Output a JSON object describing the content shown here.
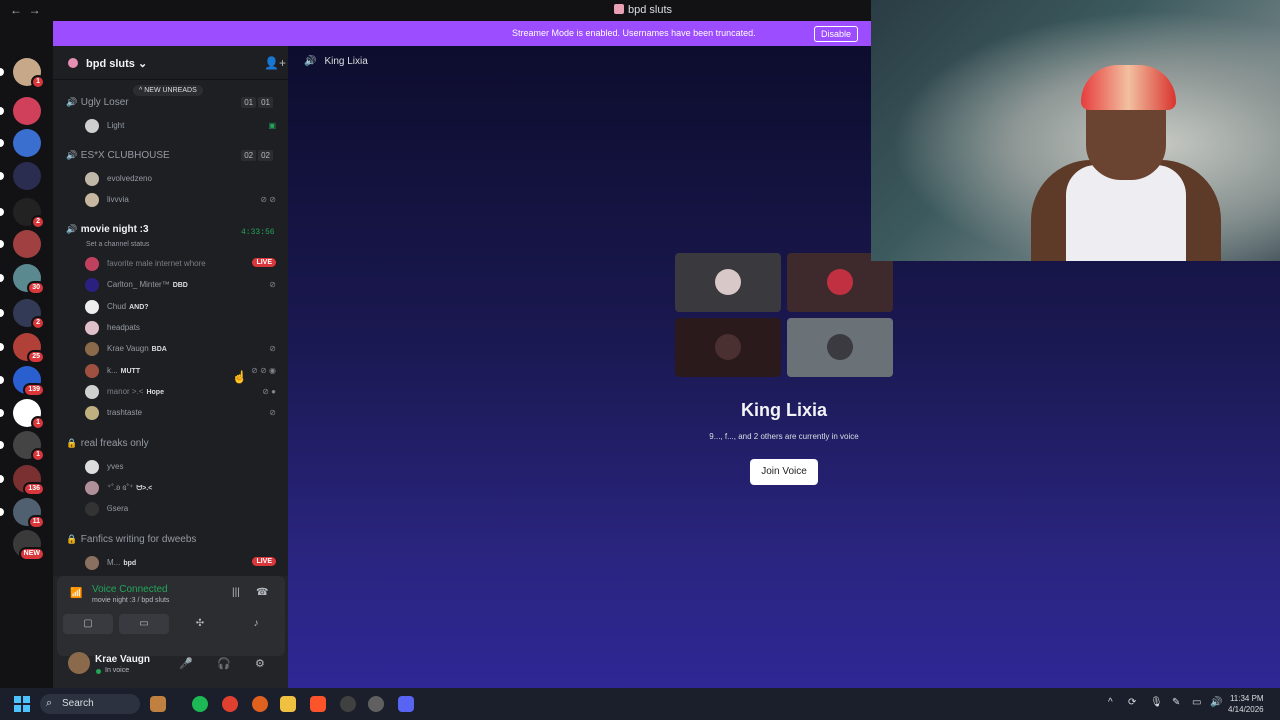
{
  "window": {
    "title": "bpd sluts",
    "back": "←",
    "forward": "→"
  },
  "banner": {
    "text": "Streamer Mode is enabled. Usernames have been truncated.",
    "button": "Disable"
  },
  "servers": [
    {
      "color": "#5865f2",
      "badge": ""
    },
    {
      "color": "#c7a98a",
      "badge": "1"
    },
    {
      "color": "#d0405a",
      "badge": ""
    },
    {
      "color": "#3a6fd0",
      "badge": ""
    },
    {
      "color": "#2a2d50",
      "badge": ""
    },
    {
      "color": "#222222",
      "badge": "2"
    },
    {
      "color": "#a04040",
      "badge": ""
    },
    {
      "color": "#5a8a90",
      "badge": "30"
    },
    {
      "color": "#333a55",
      "badge": "2"
    },
    {
      "color": "#b04038",
      "badge": "25"
    },
    {
      "color": "#2a5fd0",
      "badge": "139"
    },
    {
      "color": "#ffffff",
      "badge": "1"
    },
    {
      "color": "#444444",
      "badge": "1"
    },
    {
      "color": "#7a3030",
      "badge": "136"
    },
    {
      "color": "#506070",
      "badge": "11"
    },
    {
      "color": "#3a3a3a",
      "badge": "NEW"
    }
  ],
  "guild": {
    "name": "bpd sluts",
    "chevron": "⌄",
    "invite_icon": "👤+"
  },
  "new_unreads": "^ NEW UNREADS",
  "channels": {
    "ugly_loser": {
      "name": "Ugly Loser",
      "counts": [
        "01",
        "01"
      ],
      "users": [
        {
          "name": "Light",
          "color": "#cfcfcf"
        }
      ]
    },
    "esx": {
      "name": "ES*X CLUBHOUSE",
      "counts": [
        "02",
        "02"
      ],
      "users": [
        {
          "name": "evolvedzeno",
          "color": "#bfb8a8"
        },
        {
          "name": "livvvia",
          "color": "#c7b7a0"
        }
      ]
    },
    "movie": {
      "name": "movie night :3",
      "timer": "4:33:56",
      "status": "Set a channel status",
      "users": [
        {
          "name": "favorite male internet whore",
          "tag": "",
          "color": "#c04060",
          "live": "LIVE"
        },
        {
          "name": "Carlton_ Minter™",
          "tag": "DBD",
          "color": "#2a2080"
        },
        {
          "name": "Chud",
          "tag": "AND?",
          "color": "#eeeeee"
        },
        {
          "name": "headpats",
          "tag": "",
          "color": "#e0c0c8"
        },
        {
          "name": "Krae Vaugn",
          "tag": "BDA",
          "color": "#8a6a4a"
        },
        {
          "name": "k...",
          "tag": "MUTT",
          "color": "#a05040"
        },
        {
          "name": "manor >.<",
          "tag": "Hope",
          "color": "#d0d0d0"
        },
        {
          "name": "trashtaste",
          "tag": "",
          "color": "#c0b080"
        }
      ]
    },
    "real_freaks": {
      "name": "real freaks only",
      "users": [
        {
          "name": "yves",
          "color": "#dddddd"
        },
        {
          "name": "⁺˚.ʚ ɞ˚⁺",
          "tag": "ᗢ>.<",
          "color": "#b09098"
        },
        {
          "name": "Ꮆsera",
          "color": "#333333"
        }
      ]
    },
    "fanfics": {
      "name": "Fanfics writing for dweebs",
      "users": [
        {
          "name": "M...",
          "tag": "bpd",
          "color": "#8a7060",
          "live": "LIVE"
        }
      ]
    }
  },
  "voice_panel": {
    "title": "Voice Connected",
    "subtitle": "movie night :3 / bpd sluts"
  },
  "me": {
    "name": "Krae Vaugn",
    "status": "In voice"
  },
  "main": {
    "channel": "King Lixia",
    "tiles": [
      "#3a3a3e",
      "#3e2a2c",
      "#2a1a1c",
      "#6a7278"
    ],
    "title": "King Lixia",
    "subtitle": "9..., f..., and 2 others are currently in voice",
    "join": "Join Voice"
  },
  "taskbar": {
    "search": "Search",
    "time": "11:34 PM",
    "date": "4/14/2026"
  }
}
